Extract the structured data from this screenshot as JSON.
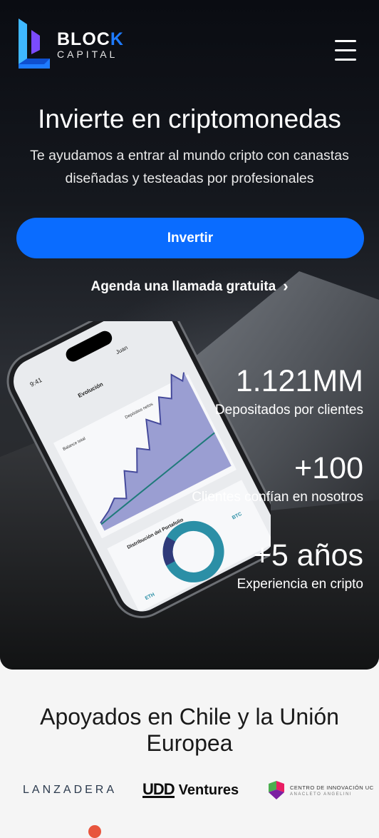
{
  "brand": {
    "line1_a": "BLOC",
    "line1_b": "K",
    "line2": "CAPITAL",
    "accent": "#1e7bff"
  },
  "header": {
    "menu_icon": "hamburger-menu-icon"
  },
  "hero": {
    "title": "Invierte en criptomonedas",
    "subtitle": "Te ayudamos a entrar al mundo cripto con canastas diseñadas y testeadas por profesionales",
    "cta_label": "Invertir",
    "cta_color": "#0a6cff",
    "secondary_link": "Agenda una llamada gratuita",
    "secondary_icon": "chevron-right-icon"
  },
  "stats": [
    {
      "value": "1.121MM",
      "label": "Depositados por clientes"
    },
    {
      "value": "+100",
      "label": "Clientes confían en nosotros"
    },
    {
      "value": "+5 años",
      "label": "Experiencia en cripto"
    }
  ],
  "phone": {
    "time": "9:41",
    "user": "Juan",
    "tab": "Evolución",
    "section": "Distribución del Portafolio",
    "legend_a": "Balance total",
    "legend_b": "Depósitos netos",
    "coin_a": "BTC",
    "coin_b": "ETH"
  },
  "partners": {
    "title": "Apoyados en Chile y la Unión Europea",
    "lanzadera": "LANZADERA",
    "udd_mark": "UDD",
    "udd_word": "Ventures",
    "centro_l1": "CENTRO DE INNOVACIÓN UC",
    "centro_l2": "ANACLETO ANGELINI"
  }
}
